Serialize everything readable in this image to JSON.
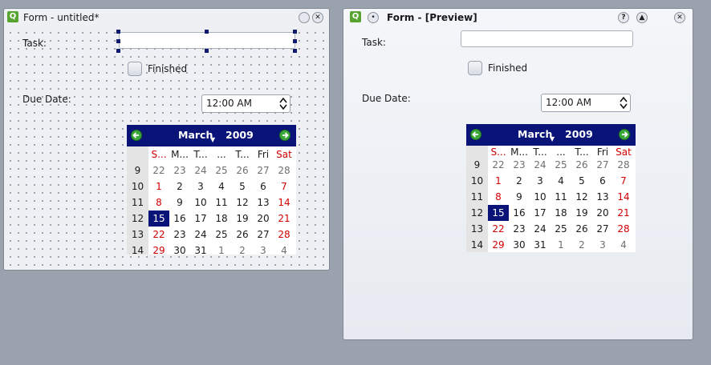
{
  "designer": {
    "title": "Form - untitled*",
    "task_label": "Task:",
    "finished_label": "Finished",
    "due_label": "Due Date:",
    "time_value": "12:00 AM"
  },
  "preview": {
    "title": "Form - [Preview]",
    "help_button": "?",
    "task_label": "Task:",
    "finished_label": "Finished",
    "due_label": "Due Date:",
    "time_value": "12:00 AM"
  },
  "calendar": {
    "month": "March",
    "year": "2009",
    "day_headers": [
      "S...",
      "M...",
      "T...",
      "...",
      "T...",
      "Fri",
      "Sat"
    ],
    "weeks": [
      {
        "wk": "9",
        "days": [
          "22",
          "23",
          "24",
          "25",
          "26",
          "27",
          "28"
        ]
      },
      {
        "wk": "10",
        "days": [
          "1",
          "2",
          "3",
          "4",
          "5",
          "6",
          "7"
        ]
      },
      {
        "wk": "11",
        "days": [
          "8",
          "9",
          "10",
          "11",
          "12",
          "13",
          "14"
        ]
      },
      {
        "wk": "12",
        "days": [
          "15",
          "16",
          "17",
          "18",
          "19",
          "20",
          "21"
        ]
      },
      {
        "wk": "13",
        "days": [
          "22",
          "23",
          "24",
          "25",
          "26",
          "27",
          "28"
        ]
      },
      {
        "wk": "14",
        "days": [
          "29",
          "30",
          "31",
          "1",
          "2",
          "3",
          "4"
        ]
      }
    ],
    "selected_day": "15",
    "colors": {
      "header_bg": "#0a1478",
      "weekend": "#d10000",
      "other_month": "#6f6f6f",
      "nav_arrow": "#3aa83a"
    }
  },
  "icons": {
    "app": "qt-designer-icon",
    "minimize": "minimize-icon",
    "close": "close-icon",
    "maximize": "maximize-icon",
    "pin": "pin-icon",
    "help": "help-icon"
  }
}
